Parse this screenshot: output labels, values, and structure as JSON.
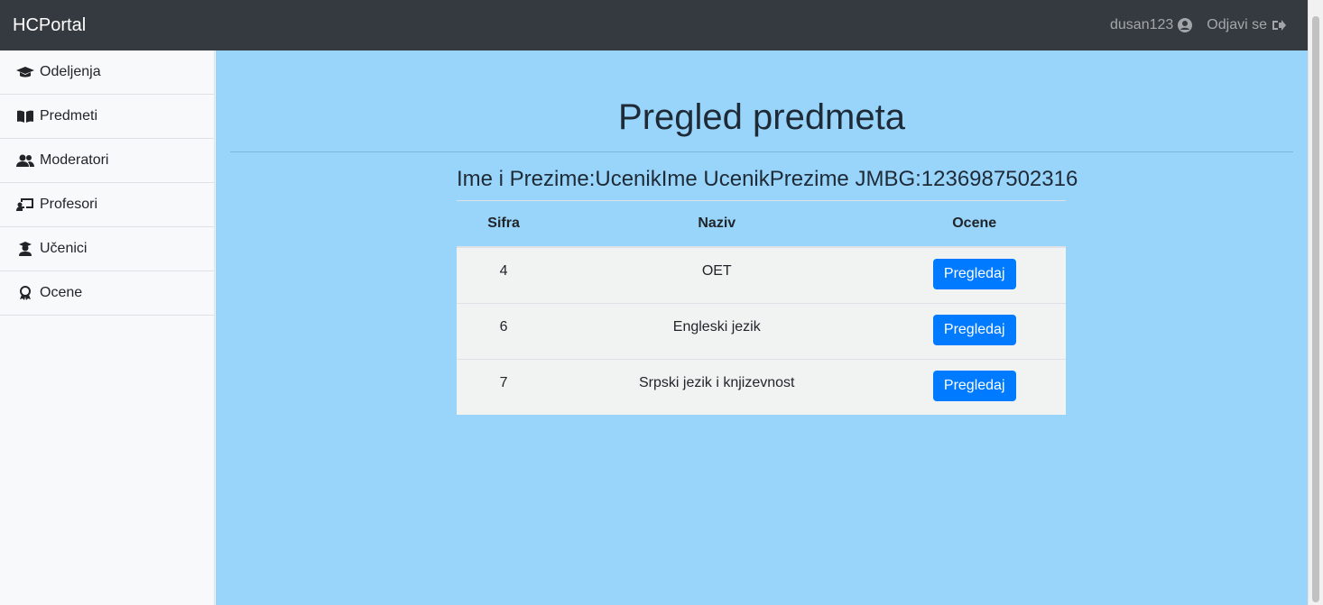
{
  "app": {
    "brand": "HCPortal"
  },
  "user": {
    "name": "dusan123",
    "logout_label": "Odjavi se"
  },
  "sidebar": {
    "items": [
      {
        "label": "Odeljenja",
        "icon": "graduation-cap-icon"
      },
      {
        "label": "Predmeti",
        "icon": "book-icon"
      },
      {
        "label": "Moderatori",
        "icon": "users-icon"
      },
      {
        "label": "Profesori",
        "icon": "chalkboard-teacher-icon"
      },
      {
        "label": "Učenici",
        "icon": "user-graduate-icon"
      },
      {
        "label": "Ocene",
        "icon": "award-icon"
      }
    ]
  },
  "main": {
    "title": "Pregled predmeta",
    "student_line": "Ime i Prezime:UcenikIme UcenikPrezime JMBG:1236987502316",
    "table": {
      "headers": [
        "Sifra",
        "Naziv",
        "Ocene"
      ],
      "rows": [
        {
          "sifra": "4",
          "naziv": "OET",
          "action": "Pregledaj"
        },
        {
          "sifra": "6",
          "naziv": "Engleski jezik",
          "action": "Pregledaj"
        },
        {
          "sifra": "7",
          "naziv": "Srpski jezik i knjizevnost",
          "action": "Pregledaj"
        }
      ]
    }
  },
  "colors": {
    "navbar": "#343a40",
    "main_bg": "#99d5fa",
    "button": "#007bff"
  }
}
